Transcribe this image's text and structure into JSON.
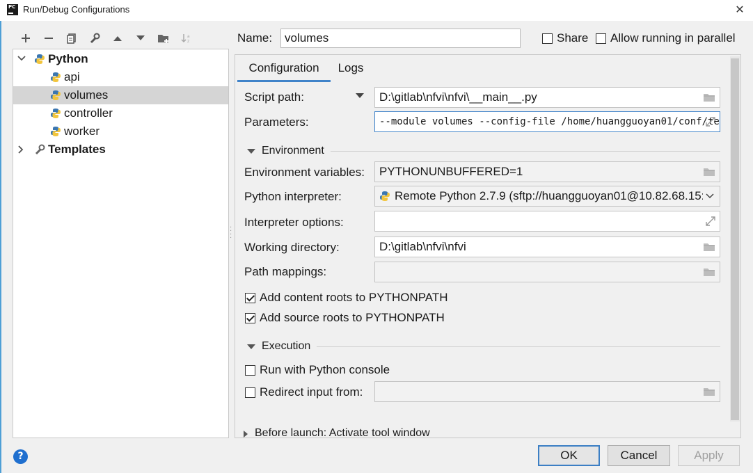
{
  "window": {
    "title": "Run/Debug Configurations",
    "app_icon": "PC"
  },
  "toolbar": {
    "buttons": [
      "add-icon",
      "remove-icon",
      "copy-icon",
      "wrench-icon",
      "move-up-icon",
      "move-down-icon",
      "folder-add-icon",
      "sort-icon"
    ]
  },
  "tree": {
    "python_label": "Python",
    "items": [
      {
        "label": "api"
      },
      {
        "label": "volumes",
        "selected": true
      },
      {
        "label": "controller"
      },
      {
        "label": "worker"
      }
    ],
    "templates_label": "Templates"
  },
  "header": {
    "name_label": "Name:",
    "name_value": "volumes",
    "share_label": "Share",
    "allow_parallel_label": "Allow running in parallel"
  },
  "tabs": [
    "Configuration",
    "Logs"
  ],
  "form": {
    "script_path_label": "Script path:",
    "script_path_value": "D:\\gitlab\\nfvi\\nfvi\\__main__.py",
    "parameters_label": "Parameters:",
    "parameters_value": "--module volumes --config-file /home/huangguoyan01/conf/te",
    "environment_section": "Environment",
    "env_vars_label": "Environment variables:",
    "env_vars_value": "PYTHONUNBUFFERED=1",
    "interpreter_label": "Python interpreter:",
    "interpreter_value": "Remote Python 2.7.9 (sftp://huangguoyan01@10.82.68.15:",
    "interp_options_label": "Interpreter options:",
    "interp_options_value": "",
    "working_dir_label": "Working directory:",
    "working_dir_value": "D:\\gitlab\\nfvi\\nfvi",
    "path_mappings_label": "Path mappings:",
    "path_mappings_value": "",
    "add_content_roots_label": "Add content roots to PYTHONPATH",
    "add_source_roots_label": "Add source roots to PYTHONPATH",
    "execution_section": "Execution",
    "run_console_label": "Run with Python console",
    "redirect_input_label": "Redirect input from:",
    "redirect_input_value": "",
    "before_launch_label": "Before launch: Activate tool window"
  },
  "buttons": {
    "ok": "OK",
    "cancel": "Cancel",
    "apply": "Apply"
  },
  "help_label": "?",
  "colors": {
    "accent": "#4083c9",
    "selection": "#d5d5d5",
    "help": "#1f6fcf"
  }
}
